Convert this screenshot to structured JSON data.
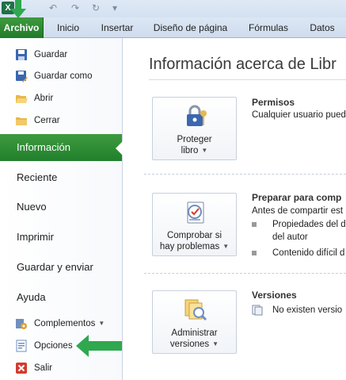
{
  "ribbon": {
    "tabs": [
      "Archivo",
      "Inicio",
      "Insertar",
      "Diseño de página",
      "Fórmulas",
      "Datos"
    ]
  },
  "nav": {
    "small_items": [
      "Guardar",
      "Guardar como",
      "Abrir",
      "Cerrar"
    ],
    "big_items": [
      "Información",
      "Reciente",
      "Nuevo",
      "Imprimir",
      "Guardar y enviar",
      "Ayuda"
    ],
    "bottom_items": [
      "Complementos",
      "Opciones",
      "Salir"
    ],
    "active": "Información"
  },
  "main": {
    "title": "Información acerca de Libr",
    "sections": [
      {
        "button_lines": [
          "Proteger",
          "libro"
        ],
        "title": "Permisos",
        "text": "Cualquier usuario pued",
        "bullets": []
      },
      {
        "button_lines": [
          "Comprobar si",
          "hay problemas"
        ],
        "title": "Preparar para comp",
        "text": "Antes de compartir est",
        "bullets": [
          "Propiedades del d",
          "del autor",
          "Contenido difícil d"
        ]
      },
      {
        "button_lines": [
          "Administrar",
          "versiones"
        ],
        "title": "Versiones",
        "text": "No existen versio",
        "bullets": []
      }
    ]
  },
  "colors": {
    "file_tab_green": "#217a2b",
    "annotation_arrow": "#2fa84f",
    "ribbon_bg": "#d3e1f1"
  }
}
